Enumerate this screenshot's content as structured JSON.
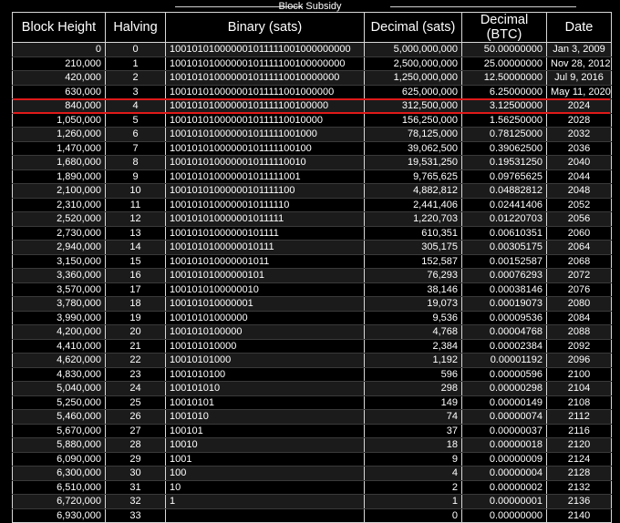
{
  "title": "Block Subsidy",
  "columns": [
    "Block Height",
    "Halving",
    "Binary (sats)",
    "Decimal (sats)",
    "Decimal (BTC)",
    "Date"
  ],
  "highlighted_row_index": 4,
  "colors": {
    "background": "#000000",
    "stripe": "#1b1b1b",
    "grid": "#d8d8d8",
    "highlight": "#e01a1a"
  },
  "rows": [
    [
      "0",
      "0",
      "100101010000001011111001000000000",
      "5,000,000,000",
      "50.00000000",
      "Jan 3, 2009"
    ],
    [
      "210,000",
      "1",
      "10010101000000101111100100000000",
      "2,500,000,000",
      "25.00000000",
      "Nov 28, 2012"
    ],
    [
      "420,000",
      "2",
      "1001010100000010111110010000000",
      "1,250,000,000",
      "12.50000000",
      "Jul 9, 2016"
    ],
    [
      "630,000",
      "3",
      "100101010000001011111001000000",
      "625,000,000",
      "6.25000000",
      "May 11, 2020"
    ],
    [
      "840,000",
      "4",
      "10010101000000101111100100000",
      "312,500,000",
      "3.12500000",
      "2024"
    ],
    [
      "1,050,000",
      "5",
      "1001010100000010111110010000",
      "156,250,000",
      "1.56250000",
      "2028"
    ],
    [
      "1,260,000",
      "6",
      "100101010000001011111001000",
      "78,125,000",
      "0.78125000",
      "2032"
    ],
    [
      "1,470,000",
      "7",
      "10010101000000101111100100",
      "39,062,500",
      "0.39062500",
      "2036"
    ],
    [
      "1,680,000",
      "8",
      "1001010100000010111110010",
      "19,531,250",
      "0.19531250",
      "2040"
    ],
    [
      "1,890,000",
      "9",
      "100101010000001011111001",
      "9,765,625",
      "0.09765625",
      "2044"
    ],
    [
      "2,100,000",
      "10",
      "10010101000000101111100",
      "4,882,812",
      "0.04882812",
      "2048"
    ],
    [
      "2,310,000",
      "11",
      "1001010100000010111110",
      "2,441,406",
      "0.02441406",
      "2052"
    ],
    [
      "2,520,000",
      "12",
      "100101010000001011111",
      "1,220,703",
      "0.01220703",
      "2056"
    ],
    [
      "2,730,000",
      "13",
      "10010101000000101111",
      "610,351",
      "0.00610351",
      "2060"
    ],
    [
      "2,940,000",
      "14",
      "1001010100000010111",
      "305,175",
      "0.00305175",
      "2064"
    ],
    [
      "3,150,000",
      "15",
      "100101010000001011",
      "152,587",
      "0.00152587",
      "2068"
    ],
    [
      "3,360,000",
      "16",
      "10010101000000101",
      "76,293",
      "0.00076293",
      "2072"
    ],
    [
      "3,570,000",
      "17",
      "1001010100000010",
      "38,146",
      "0.00038146",
      "2076"
    ],
    [
      "3,780,000",
      "18",
      "100101010000001",
      "19,073",
      "0.00019073",
      "2080"
    ],
    [
      "3,990,000",
      "19",
      "10010101000000",
      "9,536",
      "0.00009536",
      "2084"
    ],
    [
      "4,200,000",
      "20",
      "1001010100000",
      "4,768",
      "0.00004768",
      "2088"
    ],
    [
      "4,410,000",
      "21",
      "100101010000",
      "2,384",
      "0.00002384",
      "2092"
    ],
    [
      "4,620,000",
      "22",
      "10010101000",
      "1,192",
      "0.00001192",
      "2096"
    ],
    [
      "4,830,000",
      "23",
      "1001010100",
      "596",
      "0.00000596",
      "2100"
    ],
    [
      "5,040,000",
      "24",
      "100101010",
      "298",
      "0.00000298",
      "2104"
    ],
    [
      "5,250,000",
      "25",
      "10010101",
      "149",
      "0.00000149",
      "2108"
    ],
    [
      "5,460,000",
      "26",
      "1001010",
      "74",
      "0.00000074",
      "2112"
    ],
    [
      "5,670,000",
      "27",
      "100101",
      "37",
      "0.00000037",
      "2116"
    ],
    [
      "5,880,000",
      "28",
      "10010",
      "18",
      "0.00000018",
      "2120"
    ],
    [
      "6,090,000",
      "29",
      "1001",
      "9",
      "0.00000009",
      "2124"
    ],
    [
      "6,300,000",
      "30",
      "100",
      "4",
      "0.00000004",
      "2128"
    ],
    [
      "6,510,000",
      "31",
      "10",
      "2",
      "0.00000002",
      "2132"
    ],
    [
      "6,720,000",
      "32",
      "1",
      "1",
      "0.00000001",
      "2136"
    ],
    [
      "6,930,000",
      "33",
      "",
      "0",
      "0.00000000",
      "2140"
    ]
  ]
}
